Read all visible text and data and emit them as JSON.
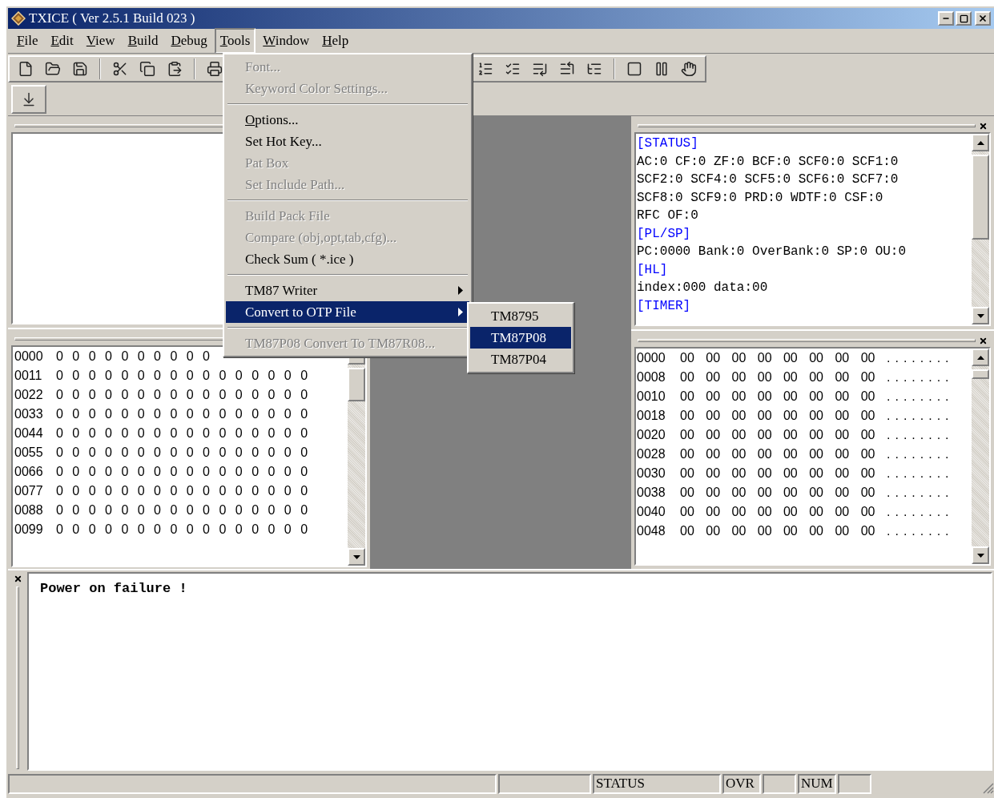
{
  "window": {
    "title": "TXICE ( Ver 2.5.1 Build 023 )"
  },
  "menu_bar": [
    {
      "label": "File",
      "selected": false
    },
    {
      "label": "Edit",
      "selected": false
    },
    {
      "label": "View",
      "selected": false
    },
    {
      "label": "Build",
      "selected": false
    },
    {
      "label": "Debug",
      "selected": false
    },
    {
      "label": "Tools",
      "selected": true
    },
    {
      "label": "Window",
      "selected": false
    },
    {
      "label": "Help",
      "selected": false
    }
  ],
  "tools_menu": [
    {
      "kind": "item",
      "label": "Font...",
      "disabled": true,
      "mnemonic": false,
      "selected": false
    },
    {
      "kind": "item",
      "label": "Keyword Color Settings...",
      "disabled": true,
      "mnemonic": false,
      "selected": false
    },
    {
      "kind": "separator"
    },
    {
      "kind": "item",
      "label": "Options...",
      "disabled": false,
      "mnemonic": true,
      "selected": false
    },
    {
      "kind": "item",
      "label": "Set Hot Key...",
      "disabled": false,
      "mnemonic": false,
      "selected": false
    },
    {
      "kind": "item",
      "label": "Pat Box",
      "disabled": true,
      "mnemonic": false,
      "selected": false
    },
    {
      "kind": "item",
      "label": "Set Include Path...",
      "disabled": true,
      "mnemonic": false,
      "selected": false
    },
    {
      "kind": "separator"
    },
    {
      "kind": "item",
      "label": "Build Pack File",
      "disabled": true,
      "mnemonic": false,
      "selected": false
    },
    {
      "kind": "item",
      "label": "Compare (obj,opt,tab,cfg)...",
      "disabled": true,
      "mnemonic": false,
      "selected": false
    },
    {
      "kind": "item",
      "label": "Check Sum ( *.ice )",
      "disabled": false,
      "mnemonic": false,
      "selected": false
    },
    {
      "kind": "separator"
    },
    {
      "kind": "submenu",
      "label": "TM87 Writer",
      "disabled": false,
      "mnemonic": false,
      "selected": false
    },
    {
      "kind": "submenu",
      "label": "Convert to OTP File",
      "disabled": false,
      "mnemonic": false,
      "selected": true
    },
    {
      "kind": "separator"
    },
    {
      "kind": "item",
      "label": "TM87P08 Convert To TM87R08...",
      "disabled": true,
      "mnemonic": false,
      "selected": false
    }
  ],
  "otp_submenu": [
    {
      "label": "TM8795",
      "selected": false
    },
    {
      "label": "TM87P08",
      "selected": true
    },
    {
      "label": "TM87P04",
      "selected": false
    }
  ],
  "program_memory": [
    {
      "address": "0000",
      "values": [
        "0",
        "0",
        "0",
        "0",
        "0",
        "0",
        "0",
        "0",
        "0",
        "0"
      ]
    },
    {
      "address": "0011",
      "values": [
        "0",
        "0",
        "0",
        "0",
        "0",
        "0",
        "0",
        "0",
        "0",
        "0",
        "0",
        "0",
        "0",
        "0",
        "0",
        "0"
      ]
    },
    {
      "address": "0022",
      "values": [
        "0",
        "0",
        "0",
        "0",
        "0",
        "0",
        "0",
        "0",
        "0",
        "0",
        "0",
        "0",
        "0",
        "0",
        "0",
        "0"
      ]
    },
    {
      "address": "0033",
      "values": [
        "0",
        "0",
        "0",
        "0",
        "0",
        "0",
        "0",
        "0",
        "0",
        "0",
        "0",
        "0",
        "0",
        "0",
        "0",
        "0"
      ]
    },
    {
      "address": "0044",
      "values": [
        "0",
        "0",
        "0",
        "0",
        "0",
        "0",
        "0",
        "0",
        "0",
        "0",
        "0",
        "0",
        "0",
        "0",
        "0",
        "0"
      ]
    },
    {
      "address": "0055",
      "values": [
        "0",
        "0",
        "0",
        "0",
        "0",
        "0",
        "0",
        "0",
        "0",
        "0",
        "0",
        "0",
        "0",
        "0",
        "0",
        "0"
      ]
    },
    {
      "address": "0066",
      "values": [
        "0",
        "0",
        "0",
        "0",
        "0",
        "0",
        "0",
        "0",
        "0",
        "0",
        "0",
        "0",
        "0",
        "0",
        "0",
        "0"
      ]
    },
    {
      "address": "0077",
      "values": [
        "0",
        "0",
        "0",
        "0",
        "0",
        "0",
        "0",
        "0",
        "0",
        "0",
        "0",
        "0",
        "0",
        "0",
        "0",
        "0"
      ]
    },
    {
      "address": "0088",
      "values": [
        "0",
        "0",
        "0",
        "0",
        "0",
        "0",
        "0",
        "0",
        "0",
        "0",
        "0",
        "0",
        "0",
        "0",
        "0",
        "0"
      ]
    },
    {
      "address": "0099",
      "values": [
        "0",
        "0",
        "0",
        "0",
        "0",
        "0",
        "0",
        "0",
        "0",
        "0",
        "0",
        "0",
        "0",
        "0",
        "0",
        "0"
      ]
    }
  ],
  "registers": [
    {
      "kind": "header",
      "text": "[STATUS]"
    },
    {
      "kind": "text",
      "text": "AC:0 CF:0 ZF:0 BCF:0 SCF0:0 SCF1:0"
    },
    {
      "kind": "text",
      "text": "SCF2:0 SCF4:0 SCF5:0 SCF6:0 SCF7:0"
    },
    {
      "kind": "text",
      "text": "SCF8:0 SCF9:0 PRD:0 WDTF:0 CSF:0"
    },
    {
      "kind": "text",
      "text": "RFC OF:0"
    },
    {
      "kind": "header",
      "text": "[PL/SP]"
    },
    {
      "kind": "text",
      "text": "PC:0000 Bank:0 OverBank:0 SP:0 OU:0"
    },
    {
      "kind": "header",
      "text": "[HL]"
    },
    {
      "kind": "text",
      "text": "index:000 data:00"
    },
    {
      "kind": "header",
      "text": "[TIMER]"
    }
  ],
  "data_memory": [
    {
      "address": "0000",
      "bytes": [
        "00",
        "00",
        "00",
        "00",
        "00",
        "00",
        "00",
        "00"
      ],
      "ascii": "........"
    },
    {
      "address": "0008",
      "bytes": [
        "00",
        "00",
        "00",
        "00",
        "00",
        "00",
        "00",
        "00"
      ],
      "ascii": "........"
    },
    {
      "address": "0010",
      "bytes": [
        "00",
        "00",
        "00",
        "00",
        "00",
        "00",
        "00",
        "00"
      ],
      "ascii": "........"
    },
    {
      "address": "0018",
      "bytes": [
        "00",
        "00",
        "00",
        "00",
        "00",
        "00",
        "00",
        "00"
      ],
      "ascii": "........"
    },
    {
      "address": "0020",
      "bytes": [
        "00",
        "00",
        "00",
        "00",
        "00",
        "00",
        "00",
        "00"
      ],
      "ascii": "........"
    },
    {
      "address": "0028",
      "bytes": [
        "00",
        "00",
        "00",
        "00",
        "00",
        "00",
        "00",
        "00"
      ],
      "ascii": "........"
    },
    {
      "address": "0030",
      "bytes": [
        "00",
        "00",
        "00",
        "00",
        "00",
        "00",
        "00",
        "00"
      ],
      "ascii": "........"
    },
    {
      "address": "0038",
      "bytes": [
        "00",
        "00",
        "00",
        "00",
        "00",
        "00",
        "00",
        "00"
      ],
      "ascii": "........"
    },
    {
      "address": "0040",
      "bytes": [
        "00",
        "00",
        "00",
        "00",
        "00",
        "00",
        "00",
        "00"
      ],
      "ascii": "........"
    },
    {
      "address": "0048",
      "bytes": [
        "00",
        "00",
        "00",
        "00",
        "00",
        "00",
        "00",
        "00"
      ],
      "ascii": "........"
    }
  ],
  "output": {
    "message": "Power on failure !"
  },
  "status_bar": {
    "panes": [
      "STATUS",
      "OVR",
      "NUM"
    ]
  }
}
